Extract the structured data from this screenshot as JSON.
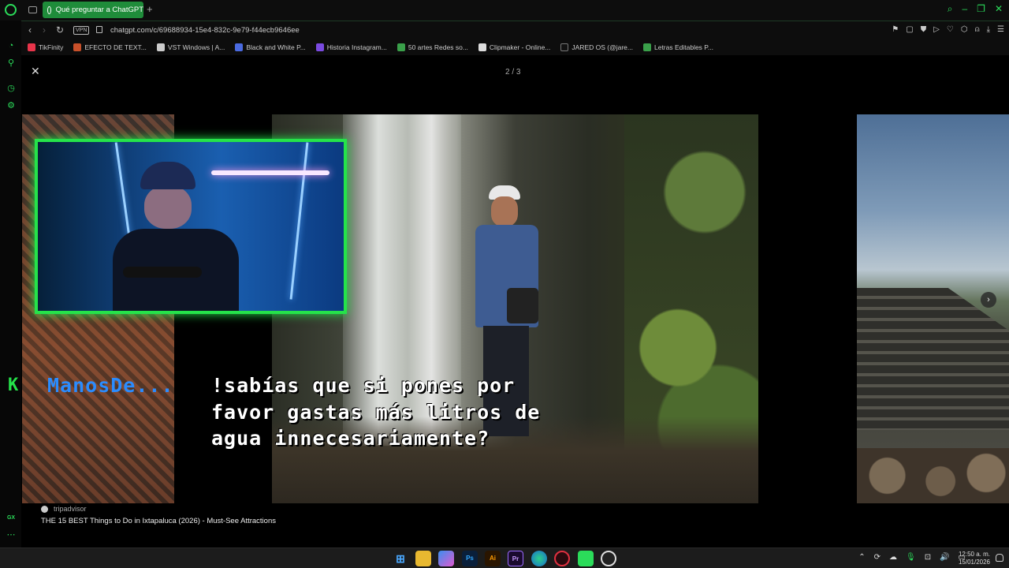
{
  "browser": {
    "tab_title": "Qué preguntar a ChatGPT",
    "url": "chatgpt.com/c/69688934-15e4-832c-9e79-f44ecb9646ee",
    "vpn_label": "VPN",
    "accent_color": "#2bdc5a"
  },
  "bookmarks": [
    {
      "label": "TikFinity",
      "color": "#e8344a"
    },
    {
      "label": "EFECTO DE TEXT...",
      "color": "#c8502a"
    },
    {
      "label": "VST Windows | A...",
      "color": "#cccccc"
    },
    {
      "label": "Black and White P...",
      "color": "#4a6ae0"
    },
    {
      "label": "Historia Instagram...",
      "color": "#7a4ae0"
    },
    {
      "label": "50 artes Redes so...",
      "color": "#3aa04a"
    },
    {
      "label": "Clipmaker - Online...",
      "color": "#dddddd"
    },
    {
      "label": "JARED OS (@jare...",
      "color": "#111111"
    },
    {
      "label": "Letras Editables P...",
      "color": "#3aa04a"
    }
  ],
  "viewer": {
    "counter": "2 / 3",
    "close_icon": "close-icon",
    "next_icon": "chevron-right-icon",
    "source_name": "tripadvisor",
    "source_title": "THE 15 BEST Things to Do in Ixtapaluca (2026) - Must-See Attractions"
  },
  "overlay": {
    "chat_prefix": "K",
    "chat_user": "ManosDe...",
    "chat_message": "!sabías que si pones por favor gastas más litros de agua innecesariamente?"
  },
  "taskbar": {
    "apps": [
      "start",
      "files",
      "copilot",
      "photoshop",
      "illustrator",
      "premiere",
      "edge",
      "opera-gx",
      "android-studio",
      "obs"
    ],
    "time": "12:50 a. m.",
    "date": "15/01/2026"
  },
  "sidebar_label": "GX"
}
